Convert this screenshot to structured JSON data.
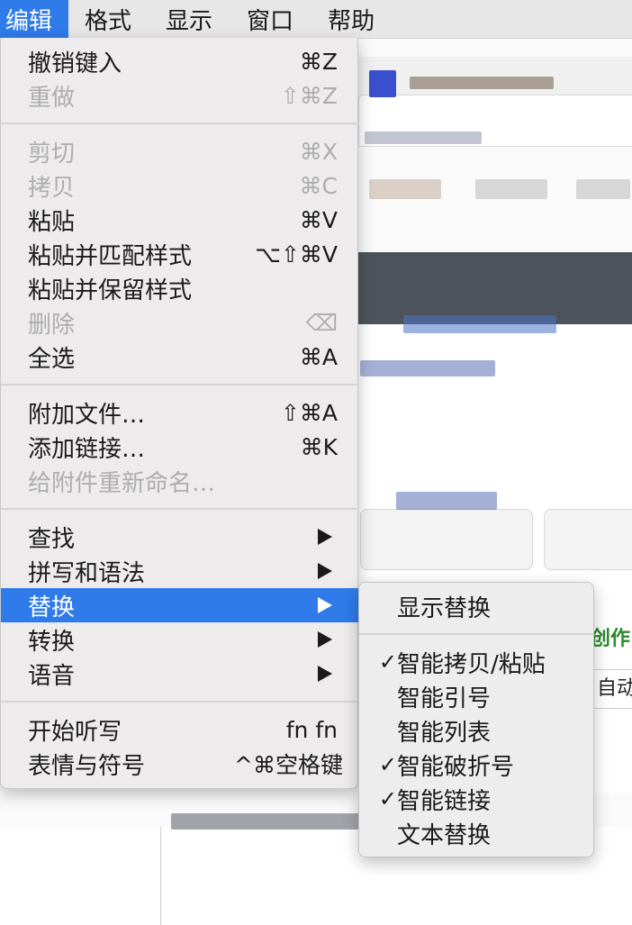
{
  "menubar": {
    "items": [
      {
        "label": "编辑"
      },
      {
        "label": "格式"
      },
      {
        "label": "显示"
      },
      {
        "label": "窗口"
      },
      {
        "label": "帮助"
      }
    ]
  },
  "background": {
    "select_value": "自动",
    "green_text": "创作"
  },
  "edit_menu": {
    "items": [
      {
        "label": "撤销键入",
        "shortcut": "⌘Z"
      },
      {
        "label": "重做",
        "shortcut": "⇧⌘Z"
      },
      {
        "label": "剪切",
        "shortcut": "⌘X"
      },
      {
        "label": "拷贝",
        "shortcut": "⌘C"
      },
      {
        "label": "粘贴",
        "shortcut": "⌘V"
      },
      {
        "label": "粘贴并匹配样式",
        "shortcut": "⌥⇧⌘V"
      },
      {
        "label": "粘贴并保留样式",
        "shortcut": ""
      },
      {
        "label": "删除",
        "shortcut": "⌫"
      },
      {
        "label": "全选",
        "shortcut": "⌘A"
      },
      {
        "label": "附加文件…",
        "shortcut": "⇧⌘A"
      },
      {
        "label": "添加链接…",
        "shortcut": "⌘K"
      },
      {
        "label": "给附件重新命名…",
        "shortcut": ""
      },
      {
        "label": "查找",
        "shortcut": ""
      },
      {
        "label": "拼写和语法",
        "shortcut": ""
      },
      {
        "label": "替换",
        "shortcut": ""
      },
      {
        "label": "转换",
        "shortcut": ""
      },
      {
        "label": "语音",
        "shortcut": ""
      },
      {
        "label": "开始听写",
        "shortcut": "fn fn"
      },
      {
        "label": "表情与符号",
        "shortcut": "^⌘空格键"
      }
    ]
  },
  "replace_submenu": {
    "items": [
      {
        "label": "显示替换",
        "check": ""
      },
      {
        "label": "智能拷贝/粘贴",
        "check": "✓"
      },
      {
        "label": "智能引号",
        "check": ""
      },
      {
        "label": "智能列表",
        "check": ""
      },
      {
        "label": "智能破折号",
        "check": "✓"
      },
      {
        "label": "智能链接",
        "check": "✓"
      },
      {
        "label": "文本替换",
        "check": ""
      }
    ]
  }
}
